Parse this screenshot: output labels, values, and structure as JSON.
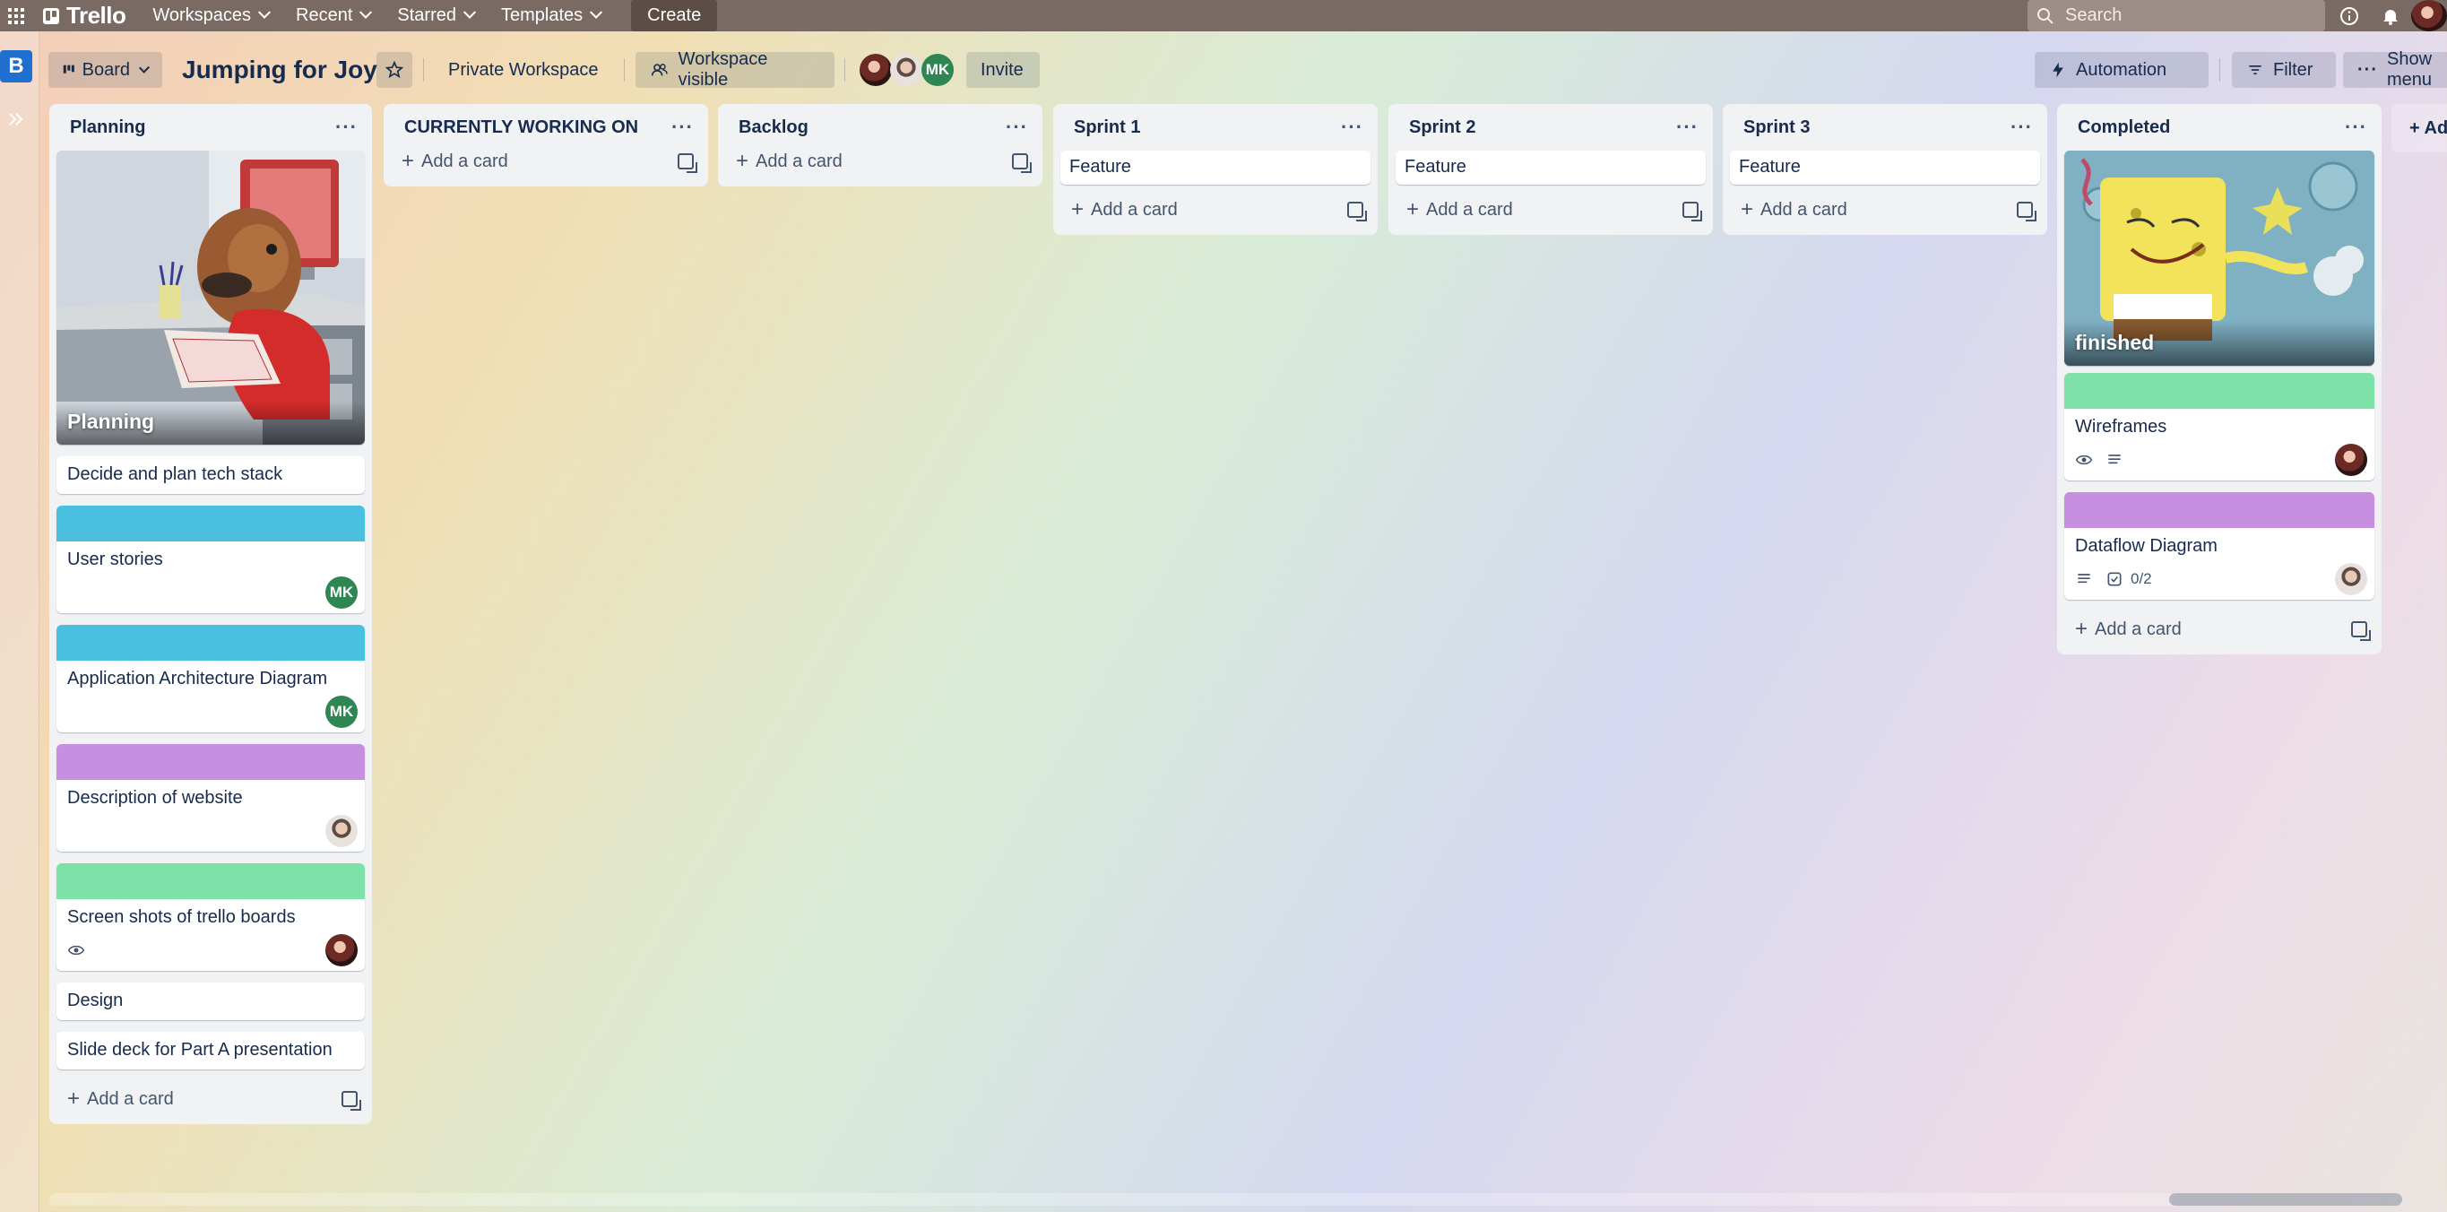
{
  "topbar": {
    "brand": "Trello",
    "nav": [
      "Workspaces",
      "Recent",
      "Starred",
      "Templates"
    ],
    "create": "Create",
    "search_placeholder": "Search"
  },
  "sidebar": {
    "workspace_initial": "B"
  },
  "board": {
    "view": "Board",
    "title": "Jumping for Joy",
    "workspace": "Private Workspace",
    "visibility": "Workspace visible",
    "members": [
      "avatar-dark-hair",
      "avatar-light",
      "MK"
    ],
    "invite": "Invite",
    "automation": "Automation",
    "filter": "Filter",
    "show_menu": "Show menu",
    "add_list": "+ Ad"
  },
  "lists": [
    {
      "title": "Planning",
      "cover": {
        "title": "Planning",
        "image": "cartoon-character-at-desk"
      },
      "cards": [
        {
          "text": "Decide and plan tech stack"
        },
        {
          "label_color": "#4bbfe0",
          "text": "User stories",
          "member": "MK"
        },
        {
          "label_color": "#4bbfe0",
          "text": "Application Architecture Diagram",
          "member": "MK"
        },
        {
          "label_color": "#c68fe0",
          "text": "Description of website",
          "member": "avatar-light"
        },
        {
          "label_color": "#7ee2a8",
          "text": "Screen shots of trello boards",
          "watch": true,
          "member": "avatar-dark-hair"
        },
        {
          "text": "Design"
        },
        {
          "text": "Slide deck for Part A presentation"
        }
      ],
      "add": "Add a card"
    },
    {
      "title": "CURRENTLY WORKING ON",
      "cards": [],
      "add": "Add a card"
    },
    {
      "title": "Backlog",
      "cards": [],
      "add": "Add a card"
    },
    {
      "title": "Sprint 1",
      "cards": [
        {
          "text": "Feature"
        }
      ],
      "add": "Add a card"
    },
    {
      "title": "Sprint 2",
      "cards": [
        {
          "text": "Feature"
        }
      ],
      "add": "Add a card"
    },
    {
      "title": "Sprint 3",
      "cards": [
        {
          "text": "Feature"
        }
      ],
      "add": "Add a card"
    },
    {
      "title": "Completed",
      "cover": {
        "title": "finished",
        "image": "spongebob-finished"
      },
      "cards": [
        {
          "label_color": "#7ee2a8",
          "text": "Wireframes",
          "watch": true,
          "description": true,
          "member": "avatar-dark-hair"
        },
        {
          "label_color": "#c68fe0",
          "text": "Dataflow Diagram",
          "description": true,
          "checklist": "0/2",
          "member": "avatar-light"
        }
      ],
      "add": "Add a card"
    }
  ]
}
